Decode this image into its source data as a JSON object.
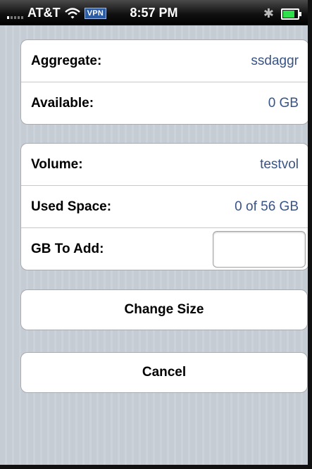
{
  "status_bar": {
    "carrier": "AT&T",
    "vpn_badge": "VPN",
    "time": "8:57 PM",
    "bluetooth_symbol": "✱",
    "icons": [
      "signal-icon",
      "wifi-icon",
      "vpn-badge",
      "bluetooth-icon",
      "battery-icon"
    ]
  },
  "aggregate_group": {
    "rows": [
      {
        "label": "Aggregate:",
        "value": "ssdaggr"
      },
      {
        "label": "Available:",
        "value": "0 GB"
      }
    ]
  },
  "volume_group": {
    "rows": [
      {
        "label": "Volume:",
        "value": "testvol"
      },
      {
        "label": "Used Space:",
        "value": "0 of 56 GB"
      },
      {
        "label": "GB To Add:",
        "value": ""
      }
    ]
  },
  "buttons": {
    "change_size": "Change Size",
    "cancel": "Cancel"
  },
  "colors": {
    "value_text": "#385487",
    "background_stripe": "#c5ccd4",
    "battery_fill": "#2ee04a"
  }
}
